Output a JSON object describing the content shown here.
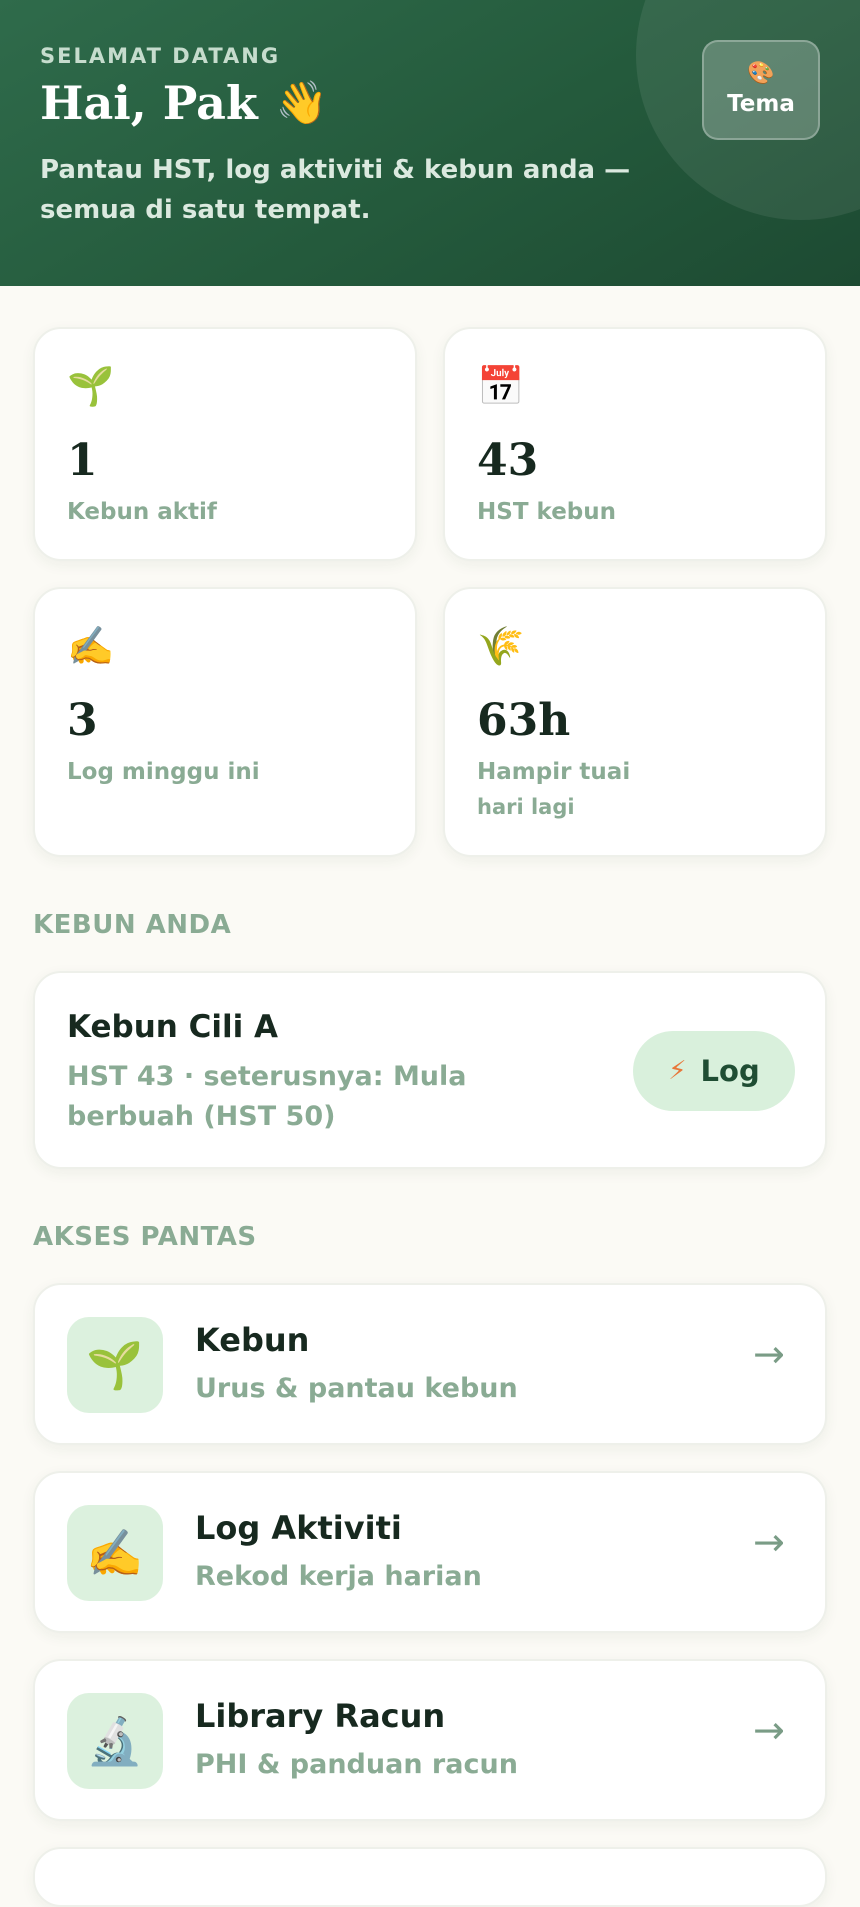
{
  "header": {
    "eyebrow": "SELAMAT DATANG",
    "greeting": "Hai, Pak",
    "greeting_emoji": "👋",
    "subtitle": "Pantau HST, log aktiviti & kebun anda — semua di satu tempat.",
    "theme_button": {
      "icon": "🎨",
      "label": "Tema"
    }
  },
  "stats": [
    {
      "icon": "🌱",
      "value": "1",
      "label": "Kebun aktif"
    },
    {
      "icon": "📅",
      "value": "43",
      "label": "HST kebun"
    },
    {
      "icon": "✍️",
      "value": "3",
      "label": "Log minggu ini"
    },
    {
      "icon": "🌾",
      "value": "63h",
      "label": "Hampir tuai",
      "sublabel": "hari lagi"
    }
  ],
  "gardens_section": {
    "title": "KEBUN ANDA",
    "items": [
      {
        "name": "Kebun Cili A",
        "info": "HST 43 · seterusnya: Mula berbuah (HST 50)",
        "log_button": {
          "icon": "⚡",
          "label": "Log"
        }
      }
    ]
  },
  "quick_access": {
    "title": "AKSES PANTAS",
    "arrow": "→",
    "items": [
      {
        "icon": "🌱",
        "title": "Kebun",
        "desc": "Urus & pantau kebun"
      },
      {
        "icon": "✍️",
        "title": "Log Aktiviti",
        "desc": "Rekod kerja harian"
      },
      {
        "icon": "🔬",
        "title": "Library Racun",
        "desc": "PHI & panduan racun"
      }
    ]
  },
  "colors": {
    "header_green": "#245a3c",
    "accent_soft": "#d9f0dc",
    "muted_text": "#8aab94",
    "background": "#fbfaf5"
  }
}
